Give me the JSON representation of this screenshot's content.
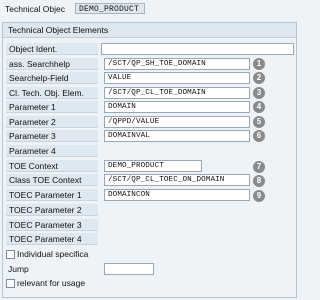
{
  "header": {
    "label": "Technical Objec",
    "value": "DEMO_PRODUCT"
  },
  "section": {
    "title": "Technical Object Elements"
  },
  "rows": [
    {
      "label": "Object Ident.",
      "value": "",
      "badge": ""
    },
    {
      "label": "ass. Searchhelp",
      "value": "/SCT/QP_SH_TOE_DOMAIN",
      "badge": "1"
    },
    {
      "label": "Searchelp-Field",
      "value": "VALUE",
      "badge": "2"
    },
    {
      "label": "Cl. Tech. Obj. Elem.",
      "value": "/SCT/QP_CL_TOE_DOMAIN",
      "badge": "3"
    },
    {
      "label": "Parameter 1",
      "value": "DOMAIN",
      "badge": "4"
    },
    {
      "label": "Parameter 2",
      "value": "/QPPD/VALUE",
      "badge": "5"
    },
    {
      "label": "Parameter 3",
      "value": "DOMAINVAL",
      "badge": "6"
    },
    {
      "label": "Parameter 4",
      "value": "",
      "badge": ""
    },
    {
      "label": "TOE Context",
      "value": "DEMO_PRODUCT",
      "badge": "7"
    },
    {
      "label": "Class TOE Context",
      "value": "/SCT/QP_CL_TOEC_ON_DOMAIN",
      "badge": "8"
    },
    {
      "label": "TOEC Parameter 1",
      "value": "DOMAINCON",
      "badge": "9"
    },
    {
      "label": "TOEC Parameter 2",
      "value": "",
      "badge": ""
    },
    {
      "label": "TOEC Parameter 3",
      "value": "",
      "badge": ""
    },
    {
      "label": "TOEC Parameter 4",
      "value": "",
      "badge": ""
    }
  ],
  "individual_specifica": {
    "label": "Individual specifica",
    "checked": false
  },
  "jump": {
    "label": "Jump",
    "value": ""
  },
  "relevant_for_usage": {
    "label": "relevant for usage",
    "checked": false
  },
  "colors": {
    "badge": "#8a8a8a",
    "label_bg": "#dde8f1",
    "page_bg": "#eef3f7"
  }
}
